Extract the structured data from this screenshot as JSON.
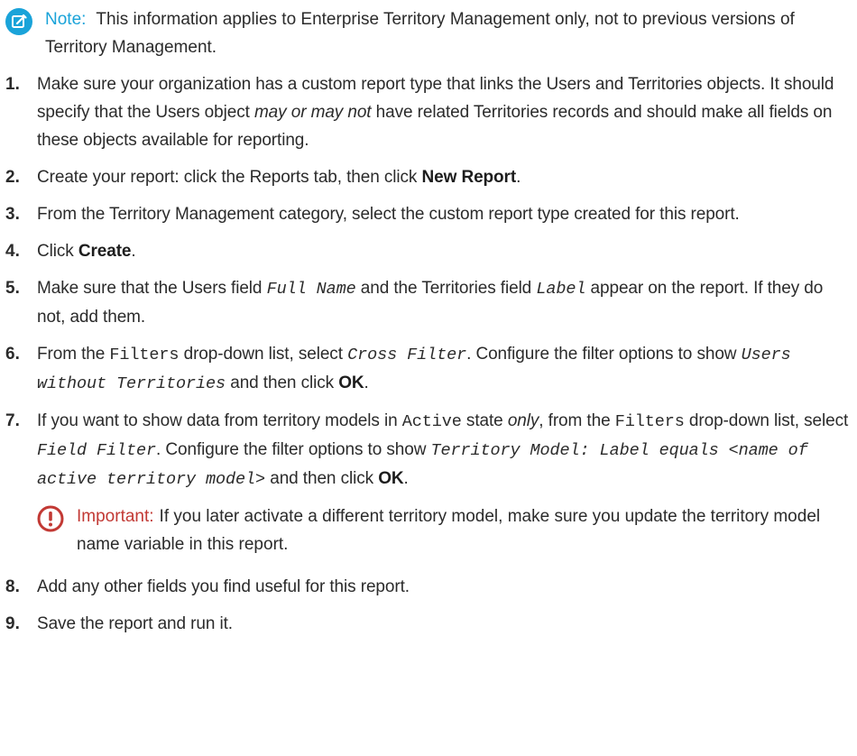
{
  "note": {
    "label": "Note:",
    "text": "This information applies to Enterprise Territory Management only, not to previous versions of Territory Management."
  },
  "steps": [
    {
      "num": "1.",
      "parts": [
        {
          "t": "Make sure your organization has a custom report type that links the Users and Territories objects. It should specify that the Users object "
        },
        {
          "t": "may or may not",
          "s": "em"
        },
        {
          "t": " have related Territories records and should make all fields on these objects available for reporting."
        }
      ]
    },
    {
      "num": "2.",
      "parts": [
        {
          "t": "Create your report: click the Reports tab, then click "
        },
        {
          "t": "New Report",
          "s": "b"
        },
        {
          "t": "."
        }
      ]
    },
    {
      "num": "3.",
      "parts": [
        {
          "t": "From the Territory Management category, select the custom report type created for this report."
        }
      ]
    },
    {
      "num": "4.",
      "parts": [
        {
          "t": "Click "
        },
        {
          "t": "Create",
          "s": "b"
        },
        {
          "t": "."
        }
      ]
    },
    {
      "num": "5.",
      "parts": [
        {
          "t": "Make sure that the Users field "
        },
        {
          "t": "Full Name",
          "s": "mono-i"
        },
        {
          "t": " and the Territories field "
        },
        {
          "t": "Label",
          "s": "mono-i"
        },
        {
          "t": " appear on the report. If they do not, add them."
        }
      ]
    },
    {
      "num": "6.",
      "parts": [
        {
          "t": "From the "
        },
        {
          "t": "Filters",
          "s": "mono"
        },
        {
          "t": " drop-down list, select "
        },
        {
          "t": "Cross Filter",
          "s": "mono-i"
        },
        {
          "t": ". Configure the filter options to show "
        },
        {
          "t": "Users without Territories",
          "s": "mono-i"
        },
        {
          "t": " and then click "
        },
        {
          "t": "OK",
          "s": "b"
        },
        {
          "t": "."
        }
      ]
    },
    {
      "num": "7.",
      "parts": [
        {
          "t": "If you want to show data from territory models in "
        },
        {
          "t": "Active",
          "s": "mono"
        },
        {
          "t": " state "
        },
        {
          "t": "only",
          "s": "em"
        },
        {
          "t": ", from the "
        },
        {
          "t": "Filters",
          "s": "mono"
        },
        {
          "t": " drop-down list, select "
        },
        {
          "t": "Field Filter",
          "s": "mono-i"
        },
        {
          "t": ". Configure the filter options to show "
        },
        {
          "t": "Territory Model: Label equals <name of active territory model>",
          "s": "mono-i"
        },
        {
          "t": " and then click "
        },
        {
          "t": "OK",
          "s": "b"
        },
        {
          "t": "."
        }
      ],
      "important": {
        "label": "Important:",
        "text": "If you later activate a different territory model, make sure you update the territory model name variable in this report."
      }
    },
    {
      "num": "8.",
      "parts": [
        {
          "t": "Add any other fields you find useful for this report."
        }
      ]
    },
    {
      "num": "9.",
      "parts": [
        {
          "t": "Save the report and run it."
        }
      ]
    }
  ],
  "colors": {
    "note_accent": "#1aa3d9",
    "important_accent": "#c23934",
    "text": "#2b2b2b"
  },
  "icons": {
    "note": "edit-note-icon",
    "important": "exclamation-circle-icon"
  }
}
